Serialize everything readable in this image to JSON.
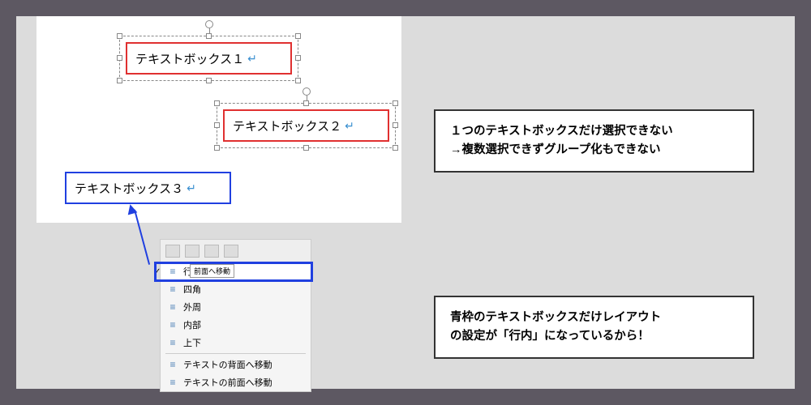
{
  "textboxes": {
    "tb1": "テキストボックス１",
    "tb2": "テキストボックス２",
    "tb3": "テキストボックス３"
  },
  "menu": {
    "inline": "行内",
    "tooltip": "前面へ移動",
    "square": "四角",
    "tight": "外周",
    "through": "内部",
    "topBottom": "上下",
    "behindText": "テキストの背面へ移動",
    "inFrontOfText": "テキストの前面へ移動"
  },
  "notes": {
    "note1_line1": "１つのテキストボックスだけ選択できない",
    "note1_line2": "→複数選択できずグループ化もできない",
    "note2_line1": "青枠のテキストボックスだけレイアウト",
    "note2_line2": "の設定が「行内」になっているから！"
  }
}
